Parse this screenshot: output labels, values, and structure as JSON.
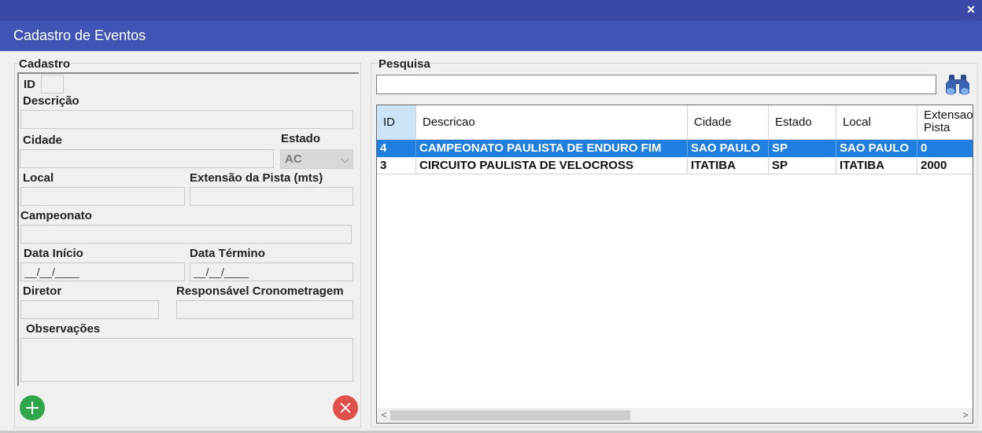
{
  "window": {
    "title": "Cadastro de Eventos",
    "close_glyph": "✕"
  },
  "cadastro": {
    "group_title": "Cadastro",
    "id_label": "ID",
    "descricao_label": "Descrição",
    "cidade_label": "Cidade",
    "estado_label": "Estado",
    "estado_value": "AC",
    "local_label": "Local",
    "extensao_label": "Extensão da Pista (mts)",
    "campeonato_label": "Campeonato",
    "data_inicio_label": "Data Início",
    "data_inicio_mask": "__/__/____",
    "data_termino_label": "Data Término",
    "data_termino_mask": "__/__/____",
    "diretor_label": "Diretor",
    "responsavel_label": "Responsável Cronometragem",
    "observacoes_label": "Observações"
  },
  "pesquisa": {
    "group_title": "Pesquisa",
    "search_value": "",
    "search_icon": "binoculars-icon"
  },
  "grid": {
    "columns": [
      "ID",
      "Descricao",
      "Cidade",
      "Estado",
      "Local",
      "Extensao Pista"
    ],
    "rows": [
      [
        "4",
        "CAMPEONATO PAULISTA DE ENDURO FIM",
        "SAO PAULO",
        "SP",
        "SAO PAULO",
        "0"
      ],
      [
        "3",
        "CIRCUITO PAULISTA DE VELOCROSS",
        "ITATIBA",
        "SP",
        "ITATIBA",
        "2000"
      ]
    ],
    "selected_row": 0,
    "scroll_left": "<",
    "scroll_right": ">"
  },
  "actions": {
    "add_icon": "plus-icon",
    "cancel_icon": "x-icon"
  },
  "colors": {
    "title_bar": "#4054b5",
    "top_strip": "#3a49a8",
    "selection": "#1e7fe0",
    "add": "#2fa64a",
    "cancel": "#e0504a"
  }
}
